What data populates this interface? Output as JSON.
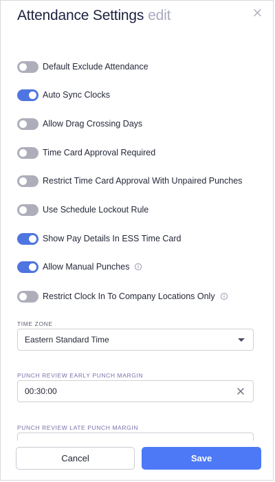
{
  "dialog": {
    "title": "Attendance Settings",
    "edit_label": "edit"
  },
  "settings": [
    {
      "label": "Default Exclude Attendance",
      "enabled": false,
      "info": false
    },
    {
      "label": "Auto Sync Clocks",
      "enabled": true,
      "info": false
    },
    {
      "label": "Allow Drag Crossing Days",
      "enabled": false,
      "info": false
    },
    {
      "label": "Time Card Approval Required",
      "enabled": false,
      "info": false
    },
    {
      "label": "Restrict Time Card Approval With Unpaired Punches",
      "enabled": false,
      "info": false
    },
    {
      "label": "Use Schedule Lockout Rule",
      "enabled": false,
      "info": false
    },
    {
      "label": "Show Pay Details In ESS Time Card",
      "enabled": true,
      "info": false
    },
    {
      "label": "Allow Manual Punches",
      "enabled": true,
      "info": true
    },
    {
      "label": "Restrict Clock In To Company Locations Only",
      "enabled": false,
      "info": true
    }
  ],
  "time_zone": {
    "label": "TIME ZONE",
    "value": "Eastern Standard Time"
  },
  "early_margin": {
    "label": "PUNCH REVIEW EARLY PUNCH MARGIN",
    "value": "00:30:00"
  },
  "late_margin": {
    "label": "PUNCH REVIEW LATE PUNCH MARGIN"
  },
  "footer": {
    "cancel_label": "Cancel",
    "save_label": "Save"
  },
  "colors": {
    "toggle_on": "#4e75e0",
    "toggle_off": "#aeaebb",
    "primary_button": "#4d79f6"
  }
}
